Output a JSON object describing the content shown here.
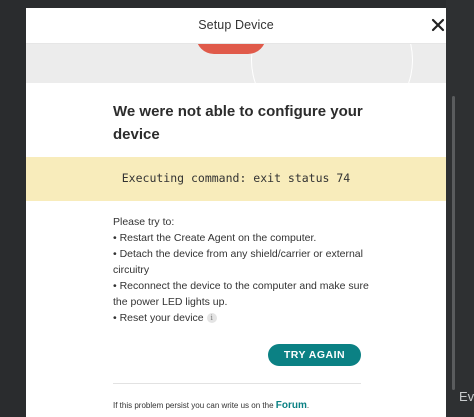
{
  "modal": {
    "title": "Setup Device",
    "heading": "We were not able to configure your device",
    "error": "Executing command: exit status 74",
    "instructions": [
      "Please try to:",
      "• Restart the Create Agent on the computer.",
      "• Detach the device from any shield/carrier or external circuitry",
      "• Reconnect the device to the computer and make sure the power LED lights up.",
      "• Reset your device"
    ],
    "button_label": "TRY AGAIN",
    "footer_text": "If this problem persist you can write us on the ",
    "footer_link": "Forum",
    "footer_end": "."
  },
  "background": {
    "edge_text": "Ev"
  },
  "colors": {
    "accent": "#0b8184",
    "error_bg": "#f8ecbb",
    "banner_red": "#e05a4a"
  },
  "icons": [
    "close-icon",
    "info-icon"
  ]
}
